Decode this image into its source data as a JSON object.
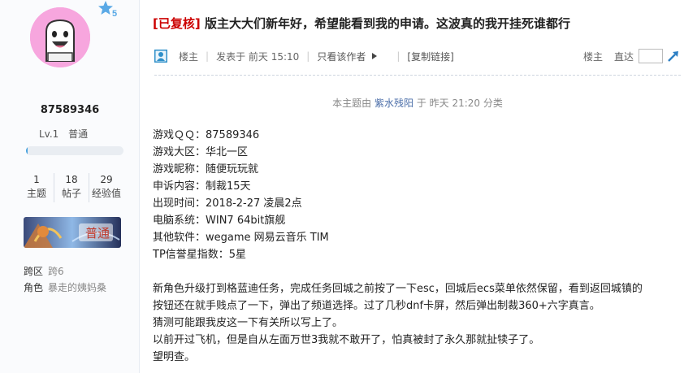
{
  "author": {
    "username": "87589346",
    "level": "Lv.1",
    "rank": "普通",
    "level_progress": 0.02,
    "stats": [
      {
        "value": "1",
        "label": "主题"
      },
      {
        "value": "18",
        "label": "帖子"
      },
      {
        "value": "29",
        "label": "经验值"
      }
    ],
    "star_badge_number": "5",
    "medal_text": "普通",
    "info": [
      {
        "key": "跨区",
        "value": "跨6"
      },
      {
        "key": "角色",
        "value": "暴走的姨妈桑"
      }
    ]
  },
  "post": {
    "tag": "[已复核]",
    "title": " 版主大大们新年好，希望能看到我的申请。这波真的我开挂死谁都行",
    "meta": {
      "role": "楼主",
      "posted": "发表于 前天 15:10",
      "only_author": "只看该作者",
      "copy_link": "[复制链接]",
      "floor": "楼主",
      "jump_label": "直达"
    },
    "edit_note_prefix": "本主题由 ",
    "edit_note_user": "紫水残阳",
    "edit_note_suffix": " 于 昨天 21:20 分类",
    "fields": [
      "游戏ＱＱ：87589346",
      "游戏大区：华北一区",
      "游戏昵称：随便玩玩就",
      "申诉内容：制裁15天",
      "出现时间：2018-2-27 凌晨2点",
      "电脑系统：WIN7 64bit旗舰",
      "其他软件：wegame 网易云音乐 TIM",
      "TP信誉星指数：5星"
    ],
    "body": [
      "新角色升级打到格蓝迪任务，完成任务回城之前按了一下esc，回城后ecs菜单依然保留，看到返回城镇的",
      "按钮还在就手贱点了一下，弹出了频道选择。过了几秒dnf卡屏，然后弹出制裁360+六字真言。",
      "猜测可能跟我皮这一下有关所以写上了。",
      "以前开过飞机，但是自从左面万世3我就不敢开了，怕真被封了永久那就扯犊子了。",
      "望明查。"
    ]
  }
}
